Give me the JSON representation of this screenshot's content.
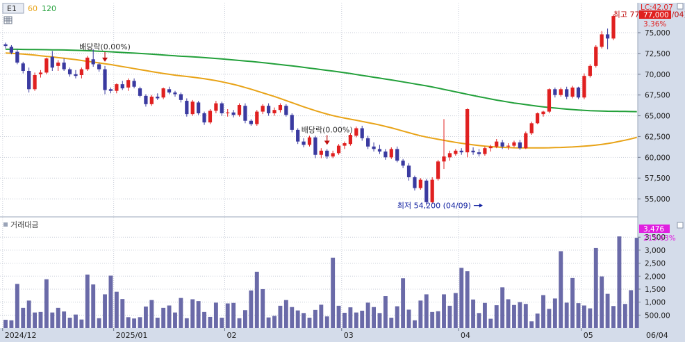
{
  "header": {
    "tag": "E1",
    "ma_labels": [
      "60",
      "120"
    ],
    "ma_colors": [
      "#e8a317",
      "#22a03a"
    ],
    "lc_label": "LC:42.07"
  },
  "volume_pane": {
    "title": "거래대금"
  },
  "colors": {
    "up": "#e02020",
    "down": "#3a3aa0",
    "volume": "#6a6aa8",
    "grid": "#c8cdd8",
    "axis_bg": "#d4dcea"
  },
  "annotations": {
    "high": "최고 77,200 (06/04)",
    "low": "최저 54,200 (04/09)",
    "dividend_1": "배당락(0.00%)",
    "dividend_2": "배당락(0.00%)"
  },
  "price_axis": {
    "ticks": [
      "75,000",
      "72,500",
      "70,000",
      "67,500",
      "65,000",
      "62,500",
      "60,000",
      "57,500",
      "55,000"
    ],
    "last_price": "77,000",
    "last_change": "3.36%"
  },
  "volume_axis": {
    "ticks": [
      "3,500",
      "3,000",
      "2,500",
      "2,000",
      "1,500",
      "1,000",
      "500.00"
    ],
    "last_value": "3,476",
    "last_change": "215.63%"
  },
  "x_axis": {
    "labels": [
      "2024/12",
      "2025/01",
      "02",
      "03",
      "04",
      "05",
      "06"
    ],
    "right_label": "06/04"
  },
  "chart_data": {
    "type": "candlestick",
    "title": "",
    "candles": [
      [
        73600,
        73800,
        73100,
        73400
      ],
      [
        73300,
        73500,
        72400,
        72600
      ],
      [
        72700,
        73000,
        71200,
        71400
      ],
      [
        71300,
        71500,
        70100,
        70400
      ],
      [
        70400,
        70800,
        67800,
        68200
      ],
      [
        68200,
        70200,
        68000,
        69900
      ],
      [
        70000,
        70500,
        69600,
        70200
      ],
      [
        70200,
        72000,
        70000,
        71900
      ],
      [
        72100,
        72800,
        70400,
        70800
      ],
      [
        71000,
        71700,
        70400,
        71400
      ],
      [
        71400,
        71900,
        70400,
        70600
      ],
      [
        70600,
        70800,
        69700,
        70000
      ],
      [
        70000,
        70500,
        69500,
        69800
      ],
      [
        69900,
        70800,
        69500,
        70600
      ],
      [
        70600,
        72200,
        70400,
        72000
      ],
      [
        71800,
        73000,
        70900,
        71200
      ],
      [
        71200,
        71400,
        70300,
        70600
      ],
      [
        70600,
        71000,
        67600,
        68100
      ],
      [
        68200,
        68400,
        67700,
        68000
      ],
      [
        68000,
        68900,
        67700,
        68800
      ],
      [
        68800,
        69200,
        68100,
        68300
      ],
      [
        68400,
        69500,
        68000,
        69300
      ],
      [
        69200,
        69500,
        68300,
        68500
      ],
      [
        68300,
        68500,
        67200,
        67400
      ],
      [
        67400,
        67600,
        66100,
        66400
      ],
      [
        66400,
        67500,
        66200,
        67300
      ],
      [
        67300,
        67700,
        66900,
        67100
      ],
      [
        67200,
        68400,
        67000,
        68300
      ],
      [
        68200,
        68500,
        67600,
        67800
      ],
      [
        67800,
        68000,
        67300,
        67600
      ],
      [
        67600,
        67800,
        66600,
        66900
      ],
      [
        66800,
        67100,
        64900,
        65200
      ],
      [
        65200,
        66900,
        65000,
        66700
      ],
      [
        66600,
        66800,
        65100,
        65300
      ],
      [
        65300,
        65500,
        63900,
        64200
      ],
      [
        64200,
        65800,
        64000,
        65600
      ],
      [
        65600,
        66800,
        65300,
        66500
      ],
      [
        66500,
        66700,
        65000,
        65300
      ],
      [
        65300,
        65800,
        64900,
        65400
      ],
      [
        65400,
        65700,
        64800,
        65100
      ],
      [
        65100,
        66500,
        64900,
        66300
      ],
      [
        66200,
        66500,
        64100,
        64400
      ],
      [
        64400,
        64600,
        63800,
        64000
      ],
      [
        64000,
        65700,
        63800,
        65500
      ],
      [
        65500,
        66400,
        65200,
        66200
      ],
      [
        66200,
        66500,
        65000,
        65300
      ],
      [
        65300,
        66000,
        65000,
        65700
      ],
      [
        65700,
        66500,
        65400,
        66300
      ],
      [
        66200,
        66400,
        64900,
        65100
      ],
      [
        65100,
        65300,
        63000,
        63300
      ],
      [
        63300,
        63500,
        61600,
        61900
      ],
      [
        61900,
        62300,
        61200,
        61500
      ],
      [
        61500,
        62600,
        61300,
        62400
      ],
      [
        62400,
        62600,
        59900,
        60300
      ],
      [
        60300,
        61100,
        59900,
        60800
      ],
      [
        60800,
        61000,
        59800,
        60100
      ],
      [
        60100,
        60800,
        59900,
        60500
      ],
      [
        60500,
        61600,
        60300,
        61400
      ],
      [
        61400,
        61900,
        61000,
        61700
      ],
      [
        61600,
        62900,
        61400,
        62700
      ],
      [
        62600,
        63700,
        62400,
        63500
      ],
      [
        63500,
        63800,
        62000,
        62300
      ],
      [
        62300,
        62600,
        61000,
        61300
      ],
      [
        61300,
        61800,
        60700,
        61000
      ],
      [
        61000,
        61500,
        60400,
        60700
      ],
      [
        60700,
        61000,
        59700,
        60000
      ],
      [
        60000,
        61200,
        59800,
        61000
      ],
      [
        61000,
        61300,
        59400,
        59600
      ],
      [
        59600,
        59800,
        58700,
        59000
      ],
      [
        59000,
        59300,
        57200,
        57600
      ],
      [
        57600,
        57800,
        56000,
        56300
      ],
      [
        56300,
        57500,
        56100,
        57300
      ],
      [
        57200,
        57400,
        54200,
        54600
      ],
      [
        54600,
        57600,
        54400,
        57300
      ],
      [
        57400,
        59700,
        57200,
        59500
      ],
      [
        59500,
        64600,
        58600,
        60100
      ],
      [
        60000,
        60800,
        59600,
        60500
      ],
      [
        60400,
        61000,
        60200,
        60800
      ],
      [
        60800,
        61100,
        60300,
        60600
      ],
      [
        60600,
        65900,
        60000,
        65800
      ],
      [
        60800,
        61200,
        60300,
        60600
      ],
      [
        60600,
        61000,
        60100,
        60400
      ],
      [
        60400,
        61300,
        60200,
        61100
      ],
      [
        61100,
        61500,
        60700,
        61300
      ],
      [
        61300,
        62200,
        61100,
        61900
      ],
      [
        61800,
        62100,
        61000,
        61300
      ],
      [
        61300,
        61700,
        60900,
        61400
      ],
      [
        61400,
        62000,
        61200,
        61800
      ],
      [
        61800,
        62100,
        60900,
        61100
      ],
      [
        61100,
        63100,
        61000,
        62900
      ],
      [
        62900,
        64300,
        62700,
        64100
      ],
      [
        64100,
        65400,
        64000,
        65300
      ],
      [
        65200,
        65600,
        64900,
        65500
      ],
      [
        65500,
        68300,
        65300,
        68200
      ],
      [
        68200,
        68400,
        67200,
        67500
      ],
      [
        67500,
        68400,
        67300,
        68200
      ],
      [
        68200,
        68500,
        67000,
        67300
      ],
      [
        67300,
        68600,
        67100,
        68400
      ],
      [
        68400,
        68500,
        67000,
        67200
      ],
      [
        67200,
        70100,
        67000,
        69800
      ],
      [
        69800,
        71200,
        69600,
        71000
      ],
      [
        71000,
        73500,
        70800,
        73300
      ],
      [
        73300,
        75200,
        73100,
        74800
      ],
      [
        74800,
        75500,
        73000,
        74300
      ],
      [
        74300,
        77200,
        74100,
        77000
      ]
    ],
    "volumes": [
      320,
      300,
      1700,
      780,
      1060,
      600,
      620,
      1880,
      600,
      780,
      640,
      400,
      520,
      330,
      2060,
      1680,
      380,
      1300,
      2020,
      1400,
      1120,
      420,
      370,
      420,
      830,
      1080,
      400,
      780,
      870,
      600,
      1160,
      380,
      1110,
      1040,
      620,
      430,
      980,
      400,
      950,
      970,
      380,
      690,
      1450,
      2170,
      1500,
      410,
      470,
      860,
      1080,
      810,
      680,
      580,
      400,
      700,
      900,
      450,
      2710,
      860,
      590,
      800,
      600,
      670,
      980,
      810,
      580,
      1230,
      400,
      840,
      1920,
      710,
      300,
      1060,
      1300,
      620,
      650,
      1300,
      860,
      1350,
      2320,
      2190,
      1100,
      580,
      970,
      360,
      880,
      1570,
      1110,
      890,
      1000,
      930,
      260,
      560,
      1270,
      740,
      1140,
      2960,
      980,
      1930,
      960,
      870,
      760,
      3080,
      1990,
      1320,
      850,
      3530,
      930,
      1460,
      3476
    ],
    "ma60": [
      72550,
      72520,
      72480,
      72430,
      72370,
      72300,
      72220,
      72150,
      72080,
      72000,
      71930,
      71850,
      71760,
      71660,
      71560,
      71460,
      71360,
      71260,
      71160,
      71040,
      70920,
      70800,
      70680,
      70560,
      70440,
      70320,
      70200,
      70090,
      69990,
      69890,
      69810,
      69730,
      69650,
      69560,
      69460,
      69350,
      69230,
      69090,
      68940,
      68780,
      68600,
      68400,
      68200,
      67980,
      67760,
      67540,
      67320,
      67080,
      66830,
      66580,
      66330,
      66080,
      65850,
      65620,
      65410,
      65210,
      65020,
      64860,
      64720,
      64590,
      64460,
      64320,
      64180,
      64040,
      63890,
      63720,
      63550,
      63360,
      63160,
      62960,
      62770,
      62600,
      62440,
      62300,
      62170,
      62040,
      61920,
      61800,
      61690,
      61590,
      61500,
      61420,
      61350,
      61290,
      61240,
      61200,
      61170,
      61150,
      61140,
      61130,
      61130,
      61130,
      61140,
      61150,
      61170,
      61190,
      61220,
      61250,
      61290,
      61340,
      61400,
      61470,
      61560,
      61660,
      61780,
      61920,
      62060,
      62220,
      62400
    ],
    "ma120": [
      73000,
      73000,
      73000,
      72990,
      72980,
      72970,
      72960,
      72950,
      72940,
      72930,
      72920,
      72900,
      72880,
      72860,
      72830,
      72800,
      72770,
      72740,
      72700,
      72660,
      72620,
      72580,
      72540,
      72500,
      72460,
      72420,
      72370,
      72320,
      72270,
      72220,
      72170,
      72130,
      72090,
      72050,
      72000,
      71950,
      71900,
      71840,
      71780,
      71720,
      71660,
      71600,
      71540,
      71470,
      71400,
      71320,
      71240,
      71160,
      71080,
      71000,
      70920,
      70830,
      70740,
      70650,
      70560,
      70470,
      70380,
      70280,
      70180,
      70080,
      69970,
      69860,
      69750,
      69640,
      69530,
      69420,
      69310,
      69200,
      69080,
      68960,
      68840,
      68720,
      68600,
      68470,
      68330,
      68180,
      68030,
      67880,
      67730,
      67580,
      67440,
      67300,
      67160,
      67020,
      66890,
      66770,
      66650,
      66540,
      66440,
      66340,
      66250,
      66160,
      66080,
      66000,
      65930,
      65860,
      65800,
      65750,
      65700,
      65660,
      65620,
      65590,
      65570,
      65550,
      65540,
      65530,
      65520,
      65510,
      65500
    ],
    "price_range": [
      53000,
      78600
    ],
    "volume_range": [
      0,
      3800
    ],
    "x_labels": [
      {
        "index": 0,
        "label": "2024/12"
      },
      {
        "index": 19,
        "label": "2025/01"
      },
      {
        "index": 38,
        "label": "02"
      },
      {
        "index": 58,
        "label": "03"
      },
      {
        "index": 78,
        "label": "04"
      },
      {
        "index": 99,
        "label": "05"
      },
      {
        "index": 118,
        "label": "06"
      }
    ],
    "high_marker": {
      "index": 118,
      "value": 77200,
      "label": "최고 77,200 (06/04)"
    },
    "low_marker": {
      "index": 82,
      "value": 54200,
      "label": "최저 54,200 (04/09)"
    },
    "dividend_markers": [
      {
        "index": 17,
        "label": "배당락(0.00%)"
      },
      {
        "index": 55,
        "label": "배당락(0.00%)"
      }
    ]
  }
}
